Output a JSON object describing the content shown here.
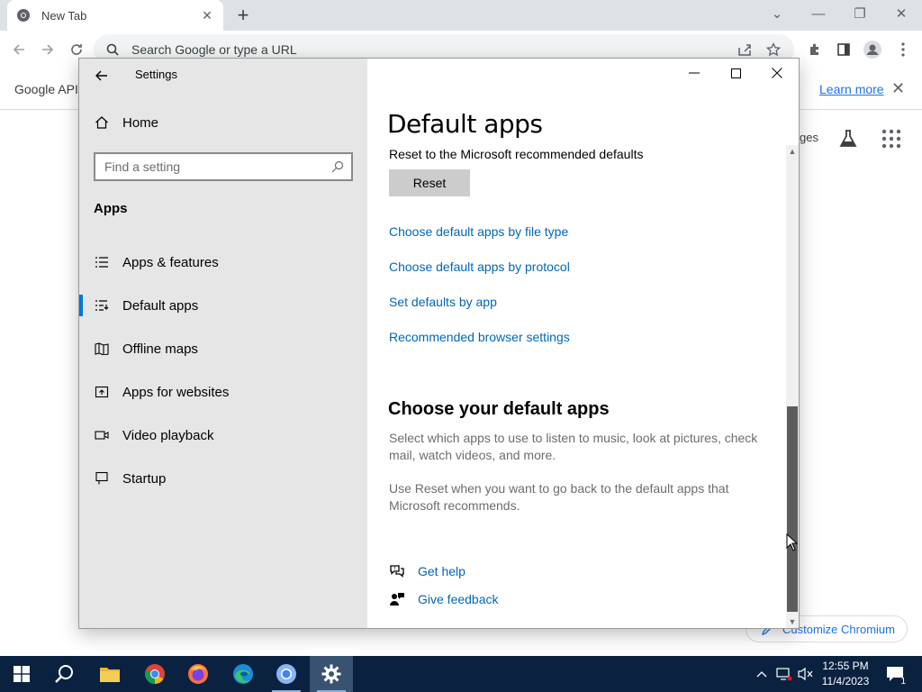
{
  "browser": {
    "tab_title": "New Tab",
    "omnibox_placeholder": "Search Google or type a URL",
    "infobar_text": "Google API k",
    "infobar_link": "Learn more",
    "ntp_images_partial": "ges",
    "customize_label": "Customize Chromium"
  },
  "settings": {
    "window_title": "Settings",
    "nav": {
      "home": "Home",
      "search_placeholder": "Find a setting",
      "section": "Apps",
      "items": [
        {
          "label": "Apps & features",
          "icon": "list-icon"
        },
        {
          "label": "Default apps",
          "icon": "default-apps-icon",
          "selected": true
        },
        {
          "label": "Offline maps",
          "icon": "map-icon"
        },
        {
          "label": "Apps for websites",
          "icon": "open-in-icon"
        },
        {
          "label": "Video playback",
          "icon": "video-icon"
        },
        {
          "label": "Startup",
          "icon": "startup-icon"
        }
      ]
    },
    "content": {
      "title": "Default apps",
      "reset_description": "Reset to the Microsoft recommended defaults",
      "reset_button": "Reset",
      "links": [
        "Choose default apps by file type",
        "Choose default apps by protocol",
        "Set defaults by app",
        "Recommended browser settings"
      ],
      "subheading": "Choose your default apps",
      "paragraph1": "Select which apps to use to listen to music, look at pictures, check mail, watch videos, and more.",
      "paragraph2": "Use Reset when you want to go back to the default apps that Microsoft recommends.",
      "get_help": "Get help",
      "give_feedback": "Give feedback"
    }
  },
  "taskbar": {
    "time": "12:55 PM",
    "date": "11/4/2023",
    "notification_count": "1",
    "accent": "#0a2240"
  }
}
